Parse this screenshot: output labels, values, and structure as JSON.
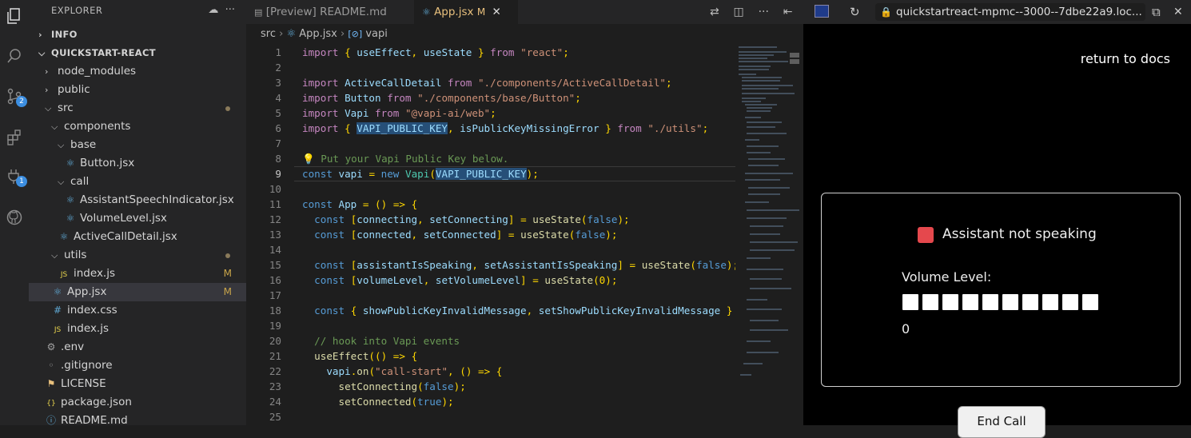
{
  "sidebar": {
    "title": "EXPLORER",
    "tree": [
      {
        "label": "INFO",
        "kind": "section-collapsed"
      },
      {
        "label": "QUICKSTART-REACT",
        "kind": "section-open"
      },
      {
        "label": "node_modules",
        "kind": "folder-collapsed",
        "depth": 1
      },
      {
        "label": "public",
        "kind": "folder-collapsed",
        "depth": 1
      },
      {
        "label": "src",
        "kind": "folder-open",
        "depth": 1,
        "badge": "dot"
      },
      {
        "label": "components",
        "kind": "folder-open",
        "depth": 2
      },
      {
        "label": "base",
        "kind": "folder-open",
        "depth": 3
      },
      {
        "label": "Button.jsx",
        "kind": "file-react",
        "depth": 4
      },
      {
        "label": "call",
        "kind": "folder-open",
        "depth": 3
      },
      {
        "label": "AssistantSpeechIndicator.jsx",
        "kind": "file-react",
        "depth": 4
      },
      {
        "label": "VolumeLevel.jsx",
        "kind": "file-react",
        "depth": 4
      },
      {
        "label": "ActiveCallDetail.jsx",
        "kind": "file-react",
        "depth": 3
      },
      {
        "label": "utils",
        "kind": "folder-open",
        "depth": 2,
        "badge": "dot"
      },
      {
        "label": "index.js",
        "kind": "file-js",
        "depth": 3,
        "badge": "M"
      },
      {
        "label": "App.jsx",
        "kind": "file-react",
        "depth": 2,
        "badge": "M",
        "selected": true
      },
      {
        "label": "index.css",
        "kind": "file-css",
        "depth": 2
      },
      {
        "label": "index.js",
        "kind": "file-js",
        "depth": 2
      },
      {
        "label": ".env",
        "kind": "file-gear",
        "depth": 1
      },
      {
        "label": ".gitignore",
        "kind": "file-dot",
        "depth": 1
      },
      {
        "label": "LICENSE",
        "kind": "file-license",
        "depth": 1
      },
      {
        "label": "package.json",
        "kind": "file-json",
        "depth": 1
      },
      {
        "label": "README.md",
        "kind": "file-info",
        "depth": 1
      }
    ]
  },
  "activity": {
    "scm_badge": "2",
    "ext_badge": "1"
  },
  "editor": {
    "tabs": [
      {
        "label": "[Preview] README.md",
        "icon": "preview-icon",
        "active": false
      },
      {
        "label": "App.jsx",
        "modified": "M",
        "icon": "react-icon",
        "active": true
      }
    ],
    "breadcrumb": {
      "root": "src",
      "file": "App.jsx",
      "symbol": "vapi"
    },
    "current_line": 9,
    "lines": [
      "import { useEffect, useState } from \"react\";",
      "",
      "import ActiveCallDetail from \"./components/ActiveCallDetail\";",
      "import Button from \"./components/base/Button\";",
      "import Vapi from \"@vapi-ai/web\";",
      "import { VAPI_PUBLIC_KEY, isPublicKeyMissingError } from \"./utils\";",
      "",
      "💡 Put your Vapi Public Key below.",
      "const vapi = new Vapi(VAPI_PUBLIC_KEY);",
      "",
      "const App = () => {",
      "  const [connecting, setConnecting] = useState(false);",
      "  const [connected, setConnected] = useState(false);",
      "",
      "  const [assistantIsSpeaking, setAssistantIsSpeaking] = useState(false);",
      "  const [volumeLevel, setVolumeLevel] = useState(0);",
      "",
      "  const { showPublicKeyInvalidMessage, setShowPublicKeyInvalidMessage }",
      "",
      "  // hook into Vapi events",
      "  useEffect(() => {",
      "    vapi.on(\"call-start\", () => {",
      "      setConnecting(false);",
      "      setConnected(true);",
      ""
    ]
  },
  "preview": {
    "url": "quickstartreact-mpmc--3000--7dbe22a9.loc...",
    "return_link": "return to docs",
    "status_text": "Assistant not speaking",
    "status_color": "#e5484d",
    "volume_label": "Volume Level:",
    "volume_value": "0",
    "volume_level": 0,
    "end_call_label": "End Call"
  }
}
